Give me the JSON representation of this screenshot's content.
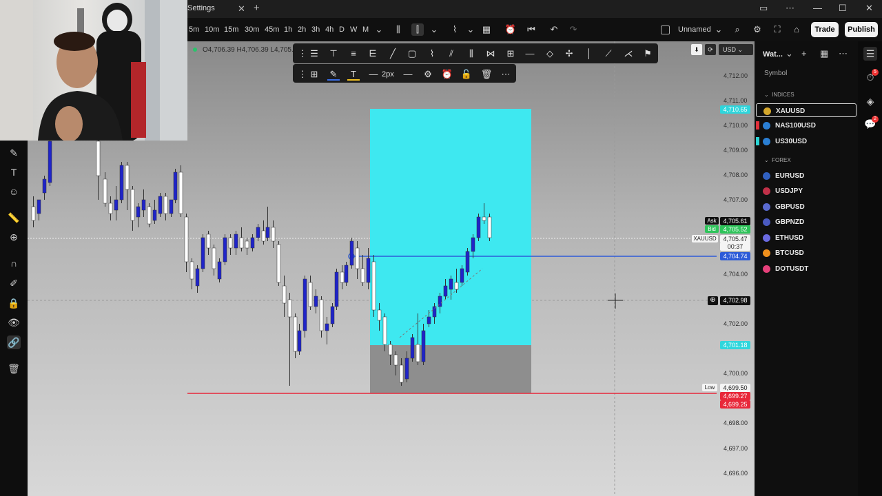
{
  "titlebar": {
    "tab_title": "Settings",
    "tab_close": "✕",
    "tab_add": "+",
    "controls": [
      "—",
      "☐",
      "✕"
    ]
  },
  "toolbar": {
    "timeframes": [
      "5m",
      "10m",
      "15m",
      "30m",
      "45m",
      "1h",
      "2h",
      "3h",
      "4h",
      "D",
      "W",
      "M"
    ],
    "layout_name": "Unnamed",
    "trade_label": "Trade",
    "publish_label": "Publish"
  },
  "chart": {
    "ohlc_text": "O4,706.39  H4,706.39  L4,705.",
    "price_labels": [
      "4,712.00",
      "4,711.00",
      "4,710.00",
      "4,709.00",
      "4,708.00",
      "4,707.00",
      "4,704.00",
      "4,702.00",
      "4,700.00",
      "4,698.00",
      "4,697.00",
      "4,696.00"
    ],
    "currency": "USD",
    "markers": {
      "top_target": "4,710.65",
      "ask_label": "Ask",
      "ask": "4,705.61",
      "bid_label": "Bid",
      "bid": "4,705.52",
      "symbol_tag": "XAUUSD",
      "last": "4,705.47",
      "countdown": "00:37",
      "hline": "4,704.74",
      "crosshair": "4,702.98",
      "entry": "4,701.18",
      "low_label": "Low",
      "low": "4,699.50",
      "red1": "4,699.27",
      "red2": "4,699.25"
    },
    "line_width_label": "2px",
    "colors": {
      "target_zone": "#3ee8f0",
      "stop_zone": "#8e8e8e",
      "low_line": "#e8283a",
      "hline": "#2d5bd8",
      "bull_candle": "#ffffff",
      "bear_candle": "#1f24c8"
    }
  },
  "watchlist": {
    "title": "Wat...",
    "column_header": "Symbol",
    "groups": [
      {
        "label": "INDICES",
        "items": [
          {
            "symbol": "XAUUSD",
            "color": "#d4a72c",
            "flag": ""
          },
          {
            "symbol": "NAS100USD",
            "color": "#2a7fd4",
            "flag": "#e0303a"
          },
          {
            "symbol": "US30USD",
            "color": "#2a7fd4",
            "flag": "#2ad4d4"
          }
        ]
      },
      {
        "label": "FOREX",
        "items": [
          {
            "symbol": "EURUSD",
            "color": "#3060c0"
          },
          {
            "symbol": "USDJPY",
            "color": "#c03048"
          },
          {
            "symbol": "GBPUSD",
            "color": "#5a6ad0"
          },
          {
            "symbol": "GBPNZD",
            "color": "#4a5ac0"
          },
          {
            "symbol": "ETHUSD",
            "color": "#6a6ae0"
          },
          {
            "symbol": "BTCUSD",
            "color": "#f0901c"
          },
          {
            "symbol": "DOTUSDT",
            "color": "#e6407a"
          }
        ]
      }
    ]
  },
  "rightbar": {
    "badge_alerts": "5",
    "badge_chat": "2"
  }
}
